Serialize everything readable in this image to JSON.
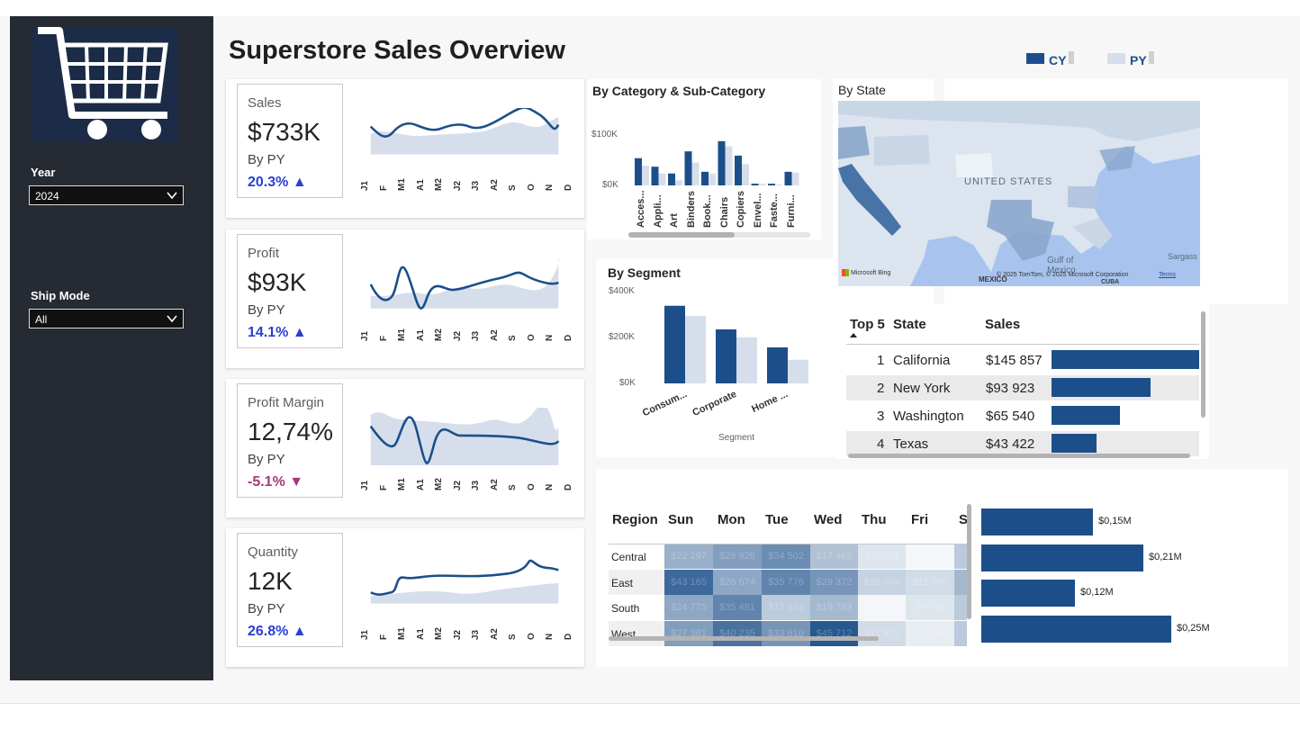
{
  "colors": {
    "cy": "#1c4f8a",
    "py": "#d6deec",
    "up": "#2a3fd4",
    "down": "#a33a7c",
    "sidebar": "#252a33"
  },
  "title": "Superstore Sales Overview",
  "legend": {
    "cy": "CY",
    "py": "PY"
  },
  "filters": {
    "year": {
      "label": "Year",
      "value": "2024"
    },
    "ship_mode": {
      "label": "Ship Mode",
      "value": "All"
    }
  },
  "months": [
    "J1",
    "F",
    "M1",
    "A1",
    "M2",
    "J2",
    "J3",
    "A2",
    "S",
    "O",
    "N",
    "D"
  ],
  "kpis": [
    {
      "name": "Sales",
      "value": "$733K",
      "by": "By PY",
      "delta": "20.3% ▲",
      "trend": "up"
    },
    {
      "name": "Profit",
      "value": "$93K",
      "by": "By PY",
      "delta": "14.1% ▲",
      "trend": "up"
    },
    {
      "name": "Profit Margin",
      "value": "12,74%",
      "by": "By PY",
      "delta": "-5.1% ▼",
      "trend": "down"
    },
    {
      "name": "Quantity",
      "value": "12K",
      "by": "By PY",
      "delta": "26.8% ▲",
      "trend": "up"
    }
  ],
  "category": {
    "title": "By Category & Sub-Category",
    "y_ticks": [
      "$100K",
      "$0K"
    ],
    "labels": [
      "Acces...",
      "Appli...",
      "Art",
      "Binders",
      "Book...",
      "Chairs",
      "Copiers",
      "Envel...",
      "Faste...",
      "Furni..."
    ]
  },
  "segment": {
    "title": "By Segment",
    "y_ticks": [
      "$400K",
      "$200K",
      "$0K"
    ],
    "labels": [
      "Consum...",
      "Corporate",
      "Home ..."
    ],
    "x_title": "Segment"
  },
  "state_map": {
    "title": "By State",
    "country": "UNITED STATES",
    "gulf": "Gulf of Mexico",
    "mexico": "MEXICO",
    "cuba": "CUBA",
    "sargasso": "Sargass",
    "bing": "Microsoft Bing",
    "copyright": "© 2025 TomTom, © 2025 Microsoft Corporation",
    "terms": "Terms"
  },
  "top5": {
    "headers": {
      "rank": "Top 5",
      "state": "State",
      "sales": "Sales"
    },
    "rows": [
      {
        "rank": "1",
        "state": "California",
        "sales": "$145 857"
      },
      {
        "rank": "2",
        "state": "New York",
        "sales": "$93 923"
      },
      {
        "rank": "3",
        "state": "Washington",
        "sales": "$65 540"
      },
      {
        "rank": "4",
        "state": "Texas",
        "sales": "$43 422"
      }
    ]
  },
  "heatmap": {
    "headers": [
      "Region",
      "Sun",
      "Mon",
      "Tue",
      "Wed",
      "Thu",
      "Fri",
      "S"
    ],
    "rows": [
      {
        "region": "Central",
        "cells": [
          "$22 297",
          "$29 926",
          "$34 502",
          "$17 462",
          "$10 011",
          "$2 483"
        ]
      },
      {
        "region": "East",
        "cells": [
          "$43 165",
          "$26 674",
          "$35 776",
          "$29 372",
          "$15 004",
          "$12 889"
        ]
      },
      {
        "region": "South",
        "cells": [
          "$24 775",
          "$35 481",
          "$13 562",
          "$19 763",
          "$4 372",
          "$9 432"
        ]
      },
      {
        "region": "West",
        "cells": [
          "$27 381",
          "$40 235",
          "$33 610",
          "$45 712",
          "$11 672",
          "$7 393"
        ]
      }
    ]
  },
  "region_bars": {
    "labels": [
      "$0,15M",
      "$0,21M",
      "$0,12M",
      "$0,25M"
    ]
  }
}
